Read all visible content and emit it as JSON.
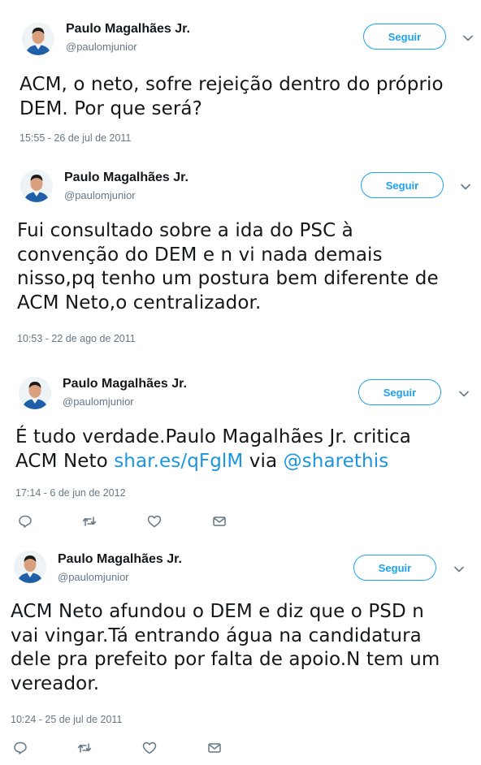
{
  "tweets": [
    {
      "author": "Paulo Magalhães Jr.",
      "handle": "@paulomjunior",
      "follow_label": "Seguir",
      "lines": [
        "ACM, o neto, sofre rejeição dentro do próprio",
        "DEM. Por que será?"
      ],
      "timestamp": "15:55 - 26 de jul de 2011"
    },
    {
      "author": "Paulo Magalhães Jr.",
      "handle": "@paulomjunior",
      "follow_label": "Seguir",
      "lines": [
        "Fui consultado sobre a ida do PSC à",
        "convenção do DEM e n vi nada demais",
        "nisso,pq tenho um postura bem diferente de",
        "ACM Neto,o centralizador."
      ],
      "timestamp": "10:53 - 22 de ago de 2011"
    },
    {
      "author": "Paulo Magalhães Jr.",
      "handle": "@paulomjunior",
      "follow_label": "Seguir",
      "line1": "É tudo verdade.Paulo Magalhães Jr. critica",
      "line2_prefix": "ACM Neto ",
      "link1": "shar.es/qFglM",
      "line2_mid": " via ",
      "link2": "@sharethis",
      "timestamp": "17:14 - 6 de jun de 2012"
    },
    {
      "author": "Paulo Magalhães Jr.",
      "handle": "@paulomjunior",
      "follow_label": "Seguir",
      "lines": [
        "ACM Neto afundou o DEM e diz que o PSD n",
        "vai vingar.Tá entrando água na candidatura",
        "dele pra prefeito por falta de apoio.N tem um",
        "vereador."
      ],
      "timestamp": "10:24 - 25 de jul de 2011"
    }
  ],
  "icons": {
    "reply": "reply-icon",
    "retweet": "retweet-icon",
    "like": "heart-icon",
    "dm": "envelope-icon",
    "menu": "chevron-down-icon"
  },
  "colors": {
    "accent": "#1da1f2",
    "link": "#1b95e0",
    "muted": "#657786",
    "text": "#14171a"
  }
}
